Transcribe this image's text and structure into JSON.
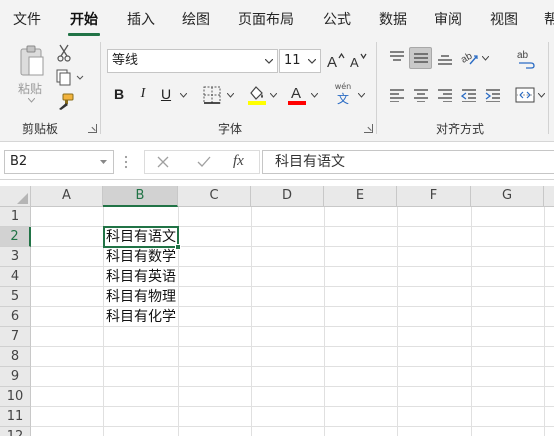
{
  "menu": {
    "tabs": [
      {
        "label": "文件"
      },
      {
        "label": "开始"
      },
      {
        "label": "插入"
      },
      {
        "label": "绘图"
      },
      {
        "label": "页面布局"
      },
      {
        "label": "公式"
      },
      {
        "label": "数据"
      },
      {
        "label": "审阅"
      },
      {
        "label": "视图"
      },
      {
        "label": "帮"
      }
    ],
    "active_tab": "开始"
  },
  "ribbon": {
    "clipboard": {
      "paste_label": "粘贴",
      "group_label": "剪贴板"
    },
    "font": {
      "font_name": "等线",
      "font_size": "11",
      "group_label": "字体",
      "bold": "B",
      "italic": "I",
      "underline": "U",
      "phonetic_top": "wén",
      "phonetic_bottom": "文",
      "highlight_color": "#ffff00",
      "font_color": "#ff0000"
    },
    "alignment": {
      "group_label": "对齐方式"
    }
  },
  "formula_bar": {
    "name_box": "B2",
    "formula": "科目有语文",
    "fx_label": "fx"
  },
  "sheet": {
    "columns": [
      "A",
      "B",
      "C",
      "D",
      "E",
      "F",
      "G"
    ],
    "rows": [
      "1",
      "2",
      "3",
      "4",
      "5",
      "6",
      "7",
      "8",
      "9",
      "10",
      "11",
      "12"
    ],
    "selected_column": "B",
    "selected_row": "2",
    "cells": {
      "B2": "科目有语文",
      "B3": "科目有数学",
      "B4": "科目有英语",
      "B5": "科目有物理",
      "B6": "科目有化学"
    }
  },
  "colors": {
    "accent": "#217346"
  }
}
